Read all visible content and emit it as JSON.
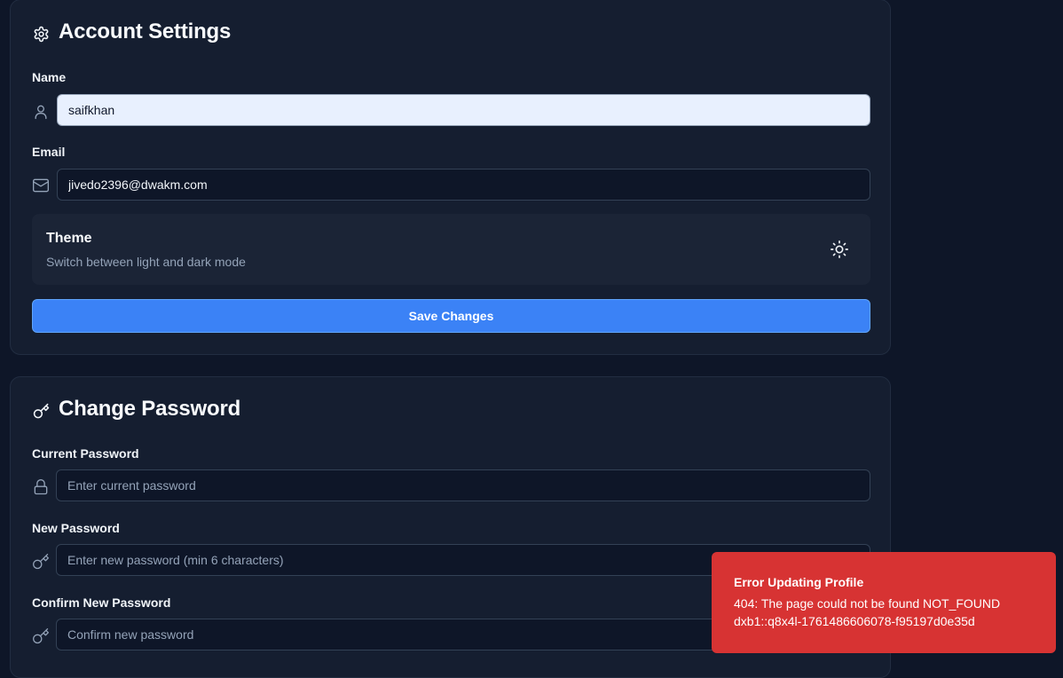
{
  "account": {
    "title": "Account Settings",
    "name_label": "Name",
    "name_value": "saifkhan",
    "email_label": "Email",
    "email_value": "jivedo2396@dwakm.com",
    "theme_title": "Theme",
    "theme_description": "Switch between light and dark mode",
    "theme_icon": "sun-icon",
    "save_label": "Save Changes"
  },
  "password": {
    "title": "Change Password",
    "current_label": "Current Password",
    "current_placeholder": "Enter current password",
    "new_label": "New Password",
    "new_placeholder": "Enter new password (min 6 characters)",
    "confirm_label": "Confirm New Password",
    "confirm_placeholder": "Confirm new password"
  },
  "toast": {
    "title": "Error Updating Profile",
    "message_line1": "404: The page could not be found NOT_FOUND",
    "message_line2": "dxb1::q8x4l-1761486606078-f95197d0e35d"
  },
  "colors": {
    "background": "#0e1628",
    "card": "#151e30",
    "accent": "#3b82f6",
    "error": "#d73333"
  }
}
